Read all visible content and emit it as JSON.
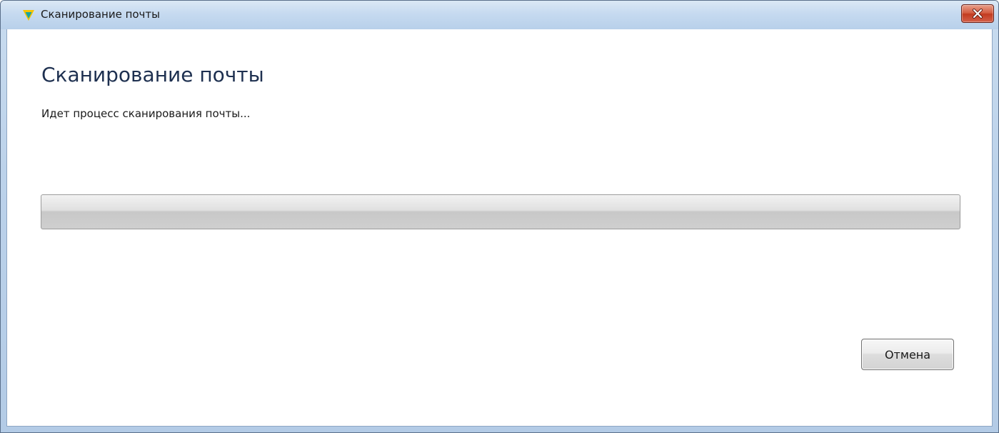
{
  "window": {
    "title": "Сканирование почты",
    "icon": "shield-v-icon",
    "close_icon": "close-icon"
  },
  "content": {
    "heading": "Сканирование почты",
    "status_text": "Идет процесс сканирования почты..."
  },
  "progress": {
    "value": 0
  },
  "buttons": {
    "cancel_label": "Отмена"
  },
  "colors": {
    "title_bar": "#c6daf0",
    "close_button": "#c94a2d",
    "heading_text": "#1e3050",
    "progress_track": "#d0d0d0",
    "app_icon_yellow": "#f5c400",
    "app_icon_teal": "#1aa3a0"
  }
}
